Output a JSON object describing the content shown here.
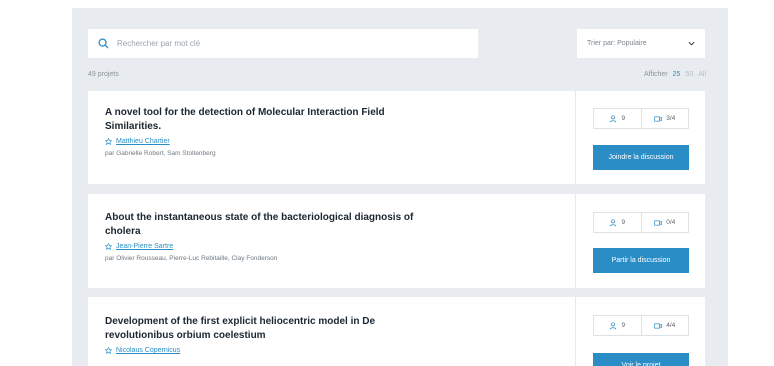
{
  "search": {
    "placeholder": "Rechercher par mot clé"
  },
  "sort": {
    "label": "Trier par: Populaire"
  },
  "summary": {
    "count_label": "49 projets",
    "display_label": "Afficher",
    "options": [
      "25",
      "50",
      "All"
    ],
    "selected": "25"
  },
  "projects": [
    {
      "title": "A novel tool for the detection of Molecular Interaction Field Similarities.",
      "owner": "Matthieu Chartier",
      "authors": "par Gabrielle Robert, Sam Stoltenberg",
      "members": "9",
      "discussions": "3/4",
      "action": "Joindre la discussion"
    },
    {
      "title": "About the instantaneous state of the bacteriological diagnosis of cholera",
      "owner": "Jean-Pierre Sartre",
      "authors": "par Olivier Rousseau, Pierre-Luc Rebitaille, Clay Fonderson",
      "members": "9",
      "discussions": "0/4",
      "action": "Partir la discussion"
    },
    {
      "title": "Development of the first explicit heliocentric model in De revolutionibus orbium coelestium",
      "owner": "Nicolaus Copernicus",
      "authors": "",
      "members": "9",
      "discussions": "4/4",
      "action": "Voir le projet"
    }
  ],
  "colors": {
    "accent": "#2b8dc6",
    "background": "#e8ecf0"
  }
}
